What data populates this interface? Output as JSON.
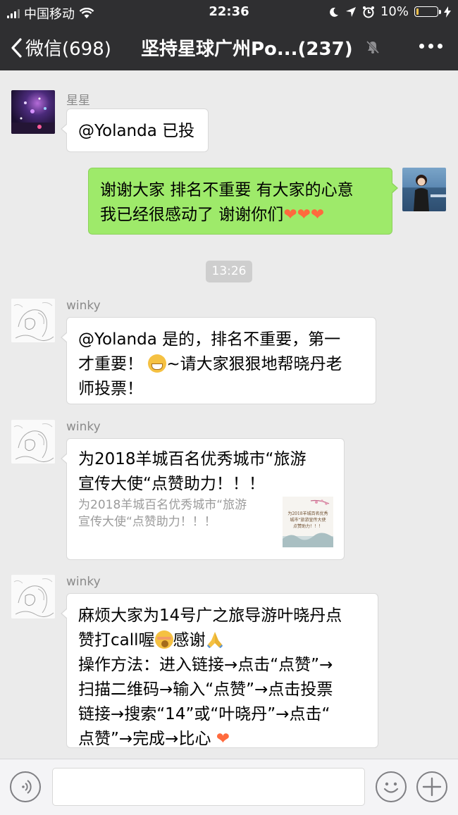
{
  "status_bar": {
    "carrier": "中国移动",
    "time": "22:36",
    "battery_percent": "10%",
    "battery_level": 0.1
  },
  "nav": {
    "back_label": "微信(698)",
    "title": "坚持星球广州Po...(237)"
  },
  "messages": [
    {
      "sender": "星星",
      "line1": "@Yolanda 已投"
    },
    {
      "sender": "self",
      "line1": "谢谢大家 排名不重要 有大家的心意",
      "line2": "我已经很感动了 谢谢你们"
    },
    {
      "sender": "winky",
      "line1": "@Yolanda 是的，排名不重要，第一",
      "line2a": "才重要！",
      "line2b": "~请大家狠狠地帮晓丹老",
      "line3": "师投票！"
    },
    {
      "sender": "winky",
      "link_title1": "为2018羊城百名优秀城市“旅游",
      "link_title2": "宣传大使“点赞助力！！！",
      "link_desc1": "为2018羊城百名优秀城市“旅游",
      "link_desc2": "宣传大使“点赞助力！！！",
      "thumb_line1": "为2018羊城百名优秀",
      "thumb_line2": "城市“旅游宣传大使",
      "thumb_line3": "点赞助力！！！"
    },
    {
      "sender": "winky",
      "line1": "麻烦大家为14号广之旅导游叶晓丹点",
      "line2a": "赞打call喔",
      "line2b": "感谢",
      "line3": "操作方法：进入链接→点击“点赞”→",
      "line4": "扫描二维码→输入“点赞”→点击投票",
      "line5": "链接→搜索“14”或“叶晓丹”→点击“",
      "line6": "点赞”→完成→比心"
    }
  ],
  "timestamp": "13:26",
  "heart": "❤",
  "colors": {
    "nav_bg": "#2f2f31",
    "chat_bg": "#ebebeb",
    "self_bubble": "#9eea6a",
    "heart": "#ff6a3d"
  }
}
